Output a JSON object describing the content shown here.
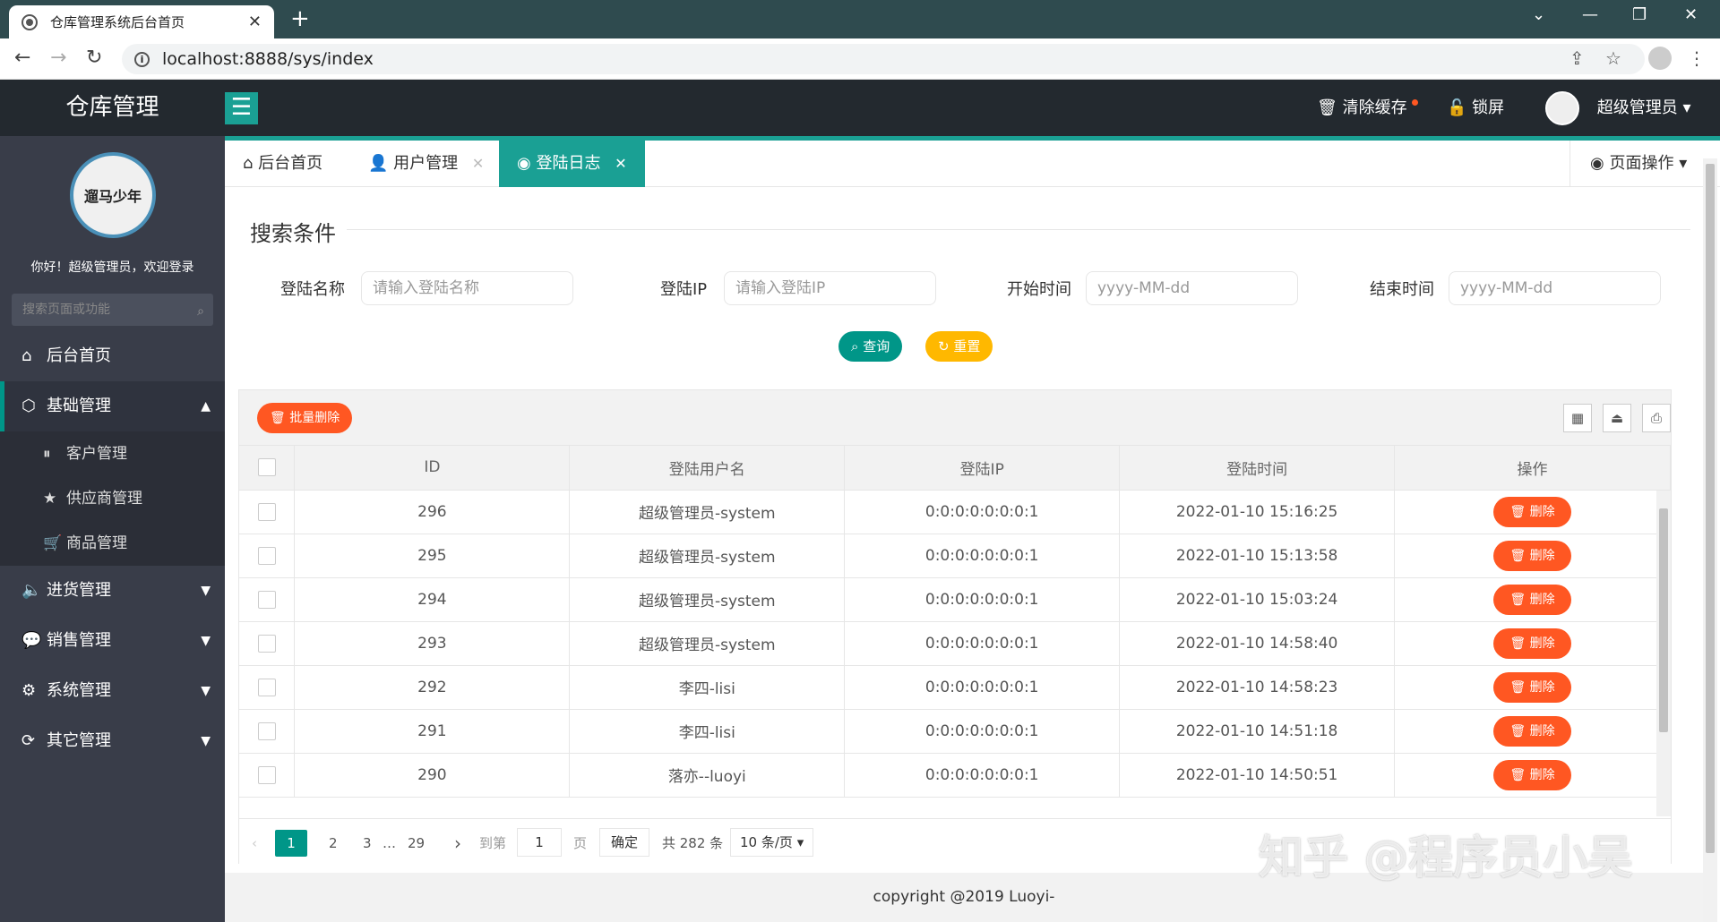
{
  "browser": {
    "tab_title": "仓库管理系统后台首页",
    "tab_close": "✕",
    "new_tab": "+",
    "url": "localhost:8888/sys/index",
    "win_chevron": "⌄",
    "win_min": "—",
    "win_restore": "❐",
    "win_close": "✕"
  },
  "topbar": {
    "logo": "仓库管理",
    "clear_cache": "清除缓存",
    "lock": "锁屏",
    "user": "超级管理员"
  },
  "sidebar": {
    "avatar_text": "遛马少年",
    "welcome": "你好！超级管理员，欢迎登录",
    "search_placeholder": "搜索页面或功能",
    "items": [
      {
        "label": "后台首页",
        "icon": "⌂"
      },
      {
        "label": "基础管理",
        "icon": "⬡"
      },
      {
        "label": "进货管理",
        "icon": "🔈"
      },
      {
        "label": "销售管理",
        "icon": "💬"
      },
      {
        "label": "系统管理",
        "icon": "⚙"
      },
      {
        "label": "其它管理",
        "icon": "⟳"
      }
    ],
    "sub_items": [
      {
        "label": "客户管理",
        "icon": "⏸"
      },
      {
        "label": "供应商管理",
        "icon": "★"
      },
      {
        "label": "商品管理",
        "icon": "🛒"
      }
    ]
  },
  "tabs": [
    {
      "label": "后台首页",
      "icon": "⌂"
    },
    {
      "label": "用户管理",
      "icon": "👤"
    },
    {
      "label": "登陆日志",
      "icon": "◉"
    }
  ],
  "page_op": "页面操作",
  "search": {
    "legend": "搜索条件",
    "fields": [
      {
        "label": "登陆名称",
        "placeholder": "请输入登陆名称"
      },
      {
        "label": "登陆IP",
        "placeholder": "请输入登陆IP"
      },
      {
        "label": "开始时间",
        "placeholder": "yyyy-MM-dd"
      },
      {
        "label": "结束时间",
        "placeholder": "yyyy-MM-dd"
      }
    ],
    "query_btn": "查询",
    "reset_btn": "重置"
  },
  "grid": {
    "batch_delete": "批量删除",
    "columns": [
      "ID",
      "登陆用户名",
      "登陆IP",
      "登陆时间",
      "操作"
    ],
    "delete_label": "删除",
    "rows": [
      [
        "296",
        "超级管理员-system",
        "0:0:0:0:0:0:0:1",
        "2022-01-10 15:16:25"
      ],
      [
        "295",
        "超级管理员-system",
        "0:0:0:0:0:0:0:1",
        "2022-01-10 15:13:58"
      ],
      [
        "294",
        "超级管理员-system",
        "0:0:0:0:0:0:0:1",
        "2022-01-10 15:03:24"
      ],
      [
        "293",
        "超级管理员-system",
        "0:0:0:0:0:0:0:1",
        "2022-01-10 14:58:40"
      ],
      [
        "292",
        "李四-lisi",
        "0:0:0:0:0:0:0:1",
        "2022-01-10 14:58:23"
      ],
      [
        "291",
        "李四-lisi",
        "0:0:0:0:0:0:0:1",
        "2022-01-10 14:51:18"
      ],
      [
        "290",
        "落亦--luoyi",
        "0:0:0:0:0:0:0:1",
        "2022-01-10 14:50:51"
      ]
    ]
  },
  "pager": {
    "pages": [
      "1",
      "2",
      "3",
      "…",
      "29"
    ],
    "goto": "到第",
    "page_value": "1",
    "page_unit": "页",
    "confirm": "确定",
    "total": "共 282 条",
    "per_page": "10 条/页"
  },
  "footer": "copyright @2019 Luoyi-",
  "watermark": "知乎 @程序员小吴",
  "colors": {
    "accent": "#1aa094",
    "danger": "#ff5722",
    "warn": "#ffb800",
    "sidebar": "#393d49"
  }
}
